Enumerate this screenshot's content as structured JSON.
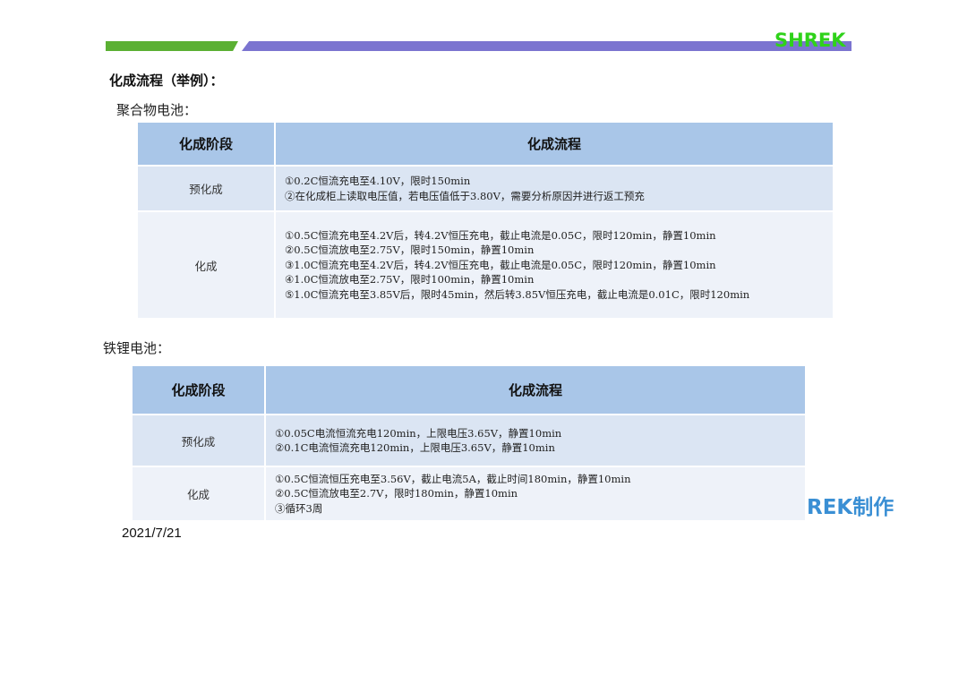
{
  "header": {
    "logo": "SHREK",
    "green_bar_color": "#5bb033",
    "purple_bar_color": "#7b74d0"
  },
  "title": "化成流程（举例）：",
  "polymer": {
    "label": "聚合物电池：",
    "headers": [
      "化成阶段",
      "化成流程"
    ],
    "rows": [
      {
        "stage": "预化成",
        "steps": [
          "①0.2C恒流充电至4.10V，限时150min",
          "②在化成柜上读取电压值，若电压值低于3.80V，需要分析原因并进行返工预充"
        ]
      },
      {
        "stage": "化成",
        "steps": [
          "①0.5C恒流充电至4.2V后，转4.2V恒压充电，截止电流是0.05C，限时120min，静置10min",
          "②0.5C恒流放电至2.75V，限时150min，静置10min",
          "③1.0C恒流充电至4.2V后，转4.2V恒压充电，截止电流是0.05C，限时120min，静置10min",
          "④1.0C恒流放电至2.75V，限时100min，静置10min",
          "⑤1.0C恒流充电至3.85V后，限时45min，然后转3.85V恒压充电，截止电流是0.01C，限时120min"
        ]
      }
    ]
  },
  "lfp": {
    "label": "铁锂电池：",
    "headers": [
      "化成阶段",
      "化成流程"
    ],
    "rows": [
      {
        "stage": "预化成",
        "steps": [
          "①0.05C电流恒流充电120min，上限电压3.65V，静置10min",
          "②0.1C电流恒流充电120min，上限电压3.65V，静置10min"
        ]
      },
      {
        "stage": "化成",
        "steps": [
          "①0.5C恒流恒压充电至3.56V，截止电流5A，截止时间180min，静置10min",
          "②0.5C恒流放电至2.7V，限时180min，静置10min",
          "③循环3周"
        ]
      }
    ]
  },
  "overlay_text": "REK制作",
  "date": "2021/7/21"
}
